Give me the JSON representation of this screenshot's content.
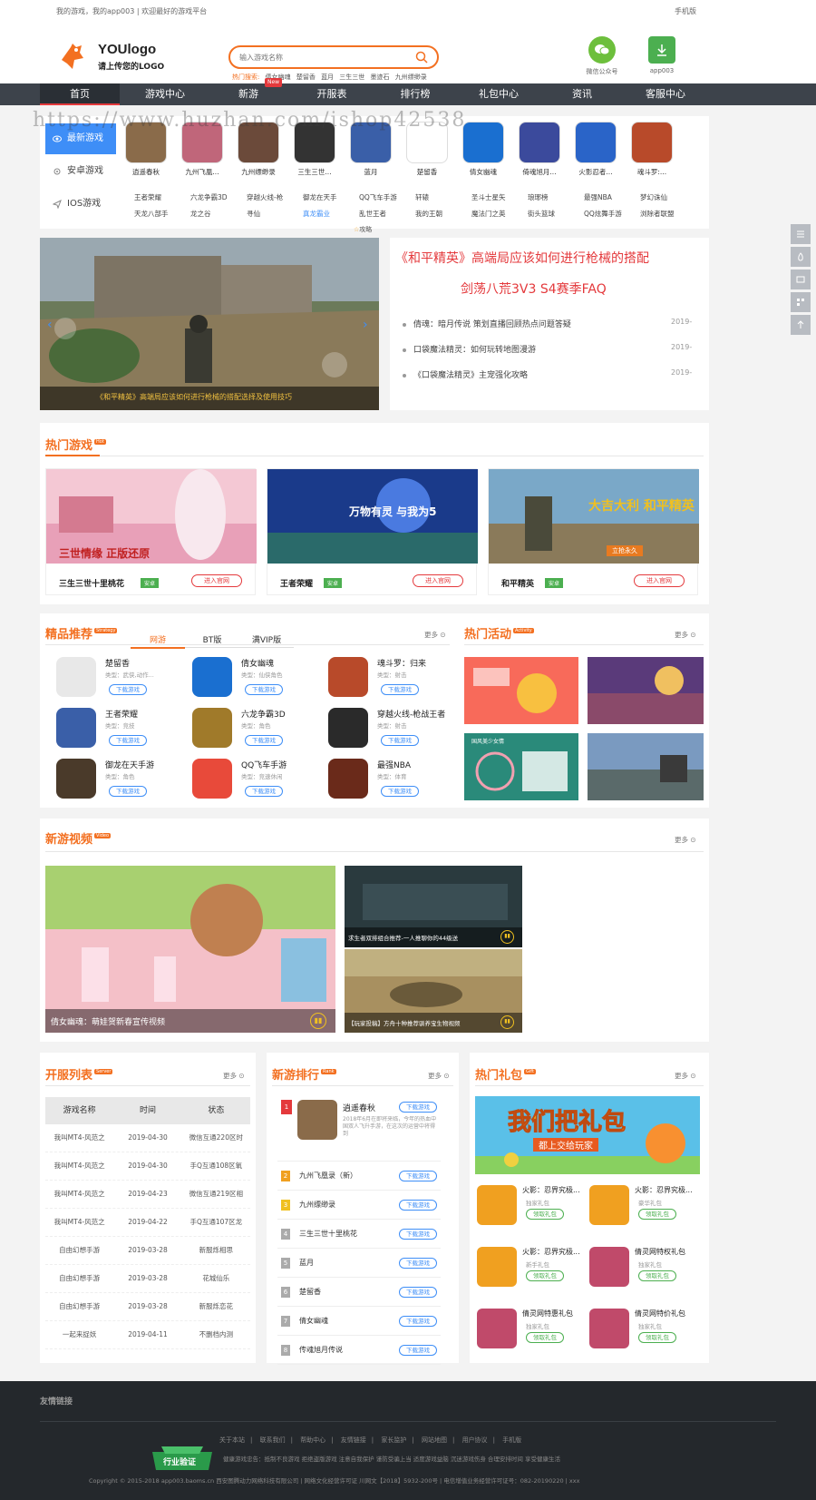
{
  "topbar": {
    "left": "我的游戏，我的app003 | 欢迎最好的游戏平台",
    "right": "手机版"
  },
  "logo": {
    "title": "YOUlogo",
    "subtitle": "请上传您的LOGO"
  },
  "search": {
    "placeholder": "输入游戏名称",
    "hot_label": "热门搜索:",
    "hot": [
      "倩女幽魂",
      "楚留香",
      "蓝月",
      "三生三世",
      "墨迹石",
      "九州缥缈录"
    ]
  },
  "header_btns": [
    {
      "label": "微信公众号",
      "icon": "wechat-icon"
    },
    {
      "label": "app003",
      "icon": "download-icon"
    }
  ],
  "nav": {
    "items": [
      "首页",
      "游戏中心",
      "新游",
      "开服表",
      "排行榜",
      "礼包中心",
      "资讯",
      "客服中心"
    ],
    "new_badge": "New"
  },
  "watermark": "https://www.huzhan.com/ishop42538",
  "platform_tabs": [
    "最新游戏",
    "安卓游戏",
    "IOS游戏"
  ],
  "latest_games": [
    {
      "name": "逍遥春秋",
      "color": "#8a6b4a"
    },
    {
      "name": "九州飞凰...",
      "color": "#c0667a"
    },
    {
      "name": "九州缥缈录",
      "color": "#6b4a3a"
    },
    {
      "name": "三生三世...",
      "color": "#333333"
    },
    {
      "name": "蓝月",
      "color": "#3a5fa8"
    },
    {
      "name": "楚留香",
      "color": "#ffffff"
    },
    {
      "name": "倩女幽魂",
      "color": "#1a6fd0"
    },
    {
      "name": "倚魂旭月...",
      "color": "#3b4a9c"
    },
    {
      "name": "火影忍者...",
      "color": "#2a64c8"
    },
    {
      "name": "魂斗罗:...",
      "color": "#b84a2a"
    }
  ],
  "name_rows": [
    [
      "王者荣耀",
      "六龙争霸3D",
      "穿越火线-枪",
      "御龙在天手",
      "QQ飞车手游",
      "轩辕",
      "圣斗士星矢",
      "琅琊榜",
      "最强NBA",
      "梦幻诛仙"
    ],
    [
      "天龙八部手",
      "龙之谷",
      "寻仙",
      "真龙霸业",
      "乱世王者",
      "我的王朝",
      "魔法门之英",
      "街头篮球",
      "QQ炫舞手游",
      "浏除者联盟"
    ]
  ],
  "strategy_label": "攻略",
  "banner": {
    "caption": "《和平精英》高端局应该如何进行枪械的搭配选择及使用技巧"
  },
  "headline": {
    "line1": "《和平精英》高端局应该如何进行枪械的搭配",
    "line2": "剑荡八荒3V3 S4赛季FAQ"
  },
  "news": [
    {
      "title": "倩魂：暗月传说 策划直播回顾热点问题答疑",
      "date": "2019-"
    },
    {
      "title": "口袋魔法精灵：如何玩转地图漫游",
      "date": "2019-"
    },
    {
      "title": "《口袋魔法精灵》主宠强化攻略",
      "date": "2019-"
    }
  ],
  "hot_games": {
    "title": "热门游戏",
    "tag": "Hot",
    "items": [
      {
        "name": "三生三世十里桃花",
        "platform": "安卓",
        "btn": "进入官网",
        "banner": "三世情缘 正版还原"
      },
      {
        "name": "王者荣耀",
        "platform": "安卓",
        "btn": "进入官网",
        "banner": "万物有灵 与我为5"
      },
      {
        "name": "和平精英",
        "platform": "安卓",
        "btn": "进入官网",
        "banner": "大吉大利 和平精英",
        "sub": "立抢永久"
      }
    ]
  },
  "recommend": {
    "title": "精品推荐",
    "tag": "Strategy",
    "tabs": [
      "网游",
      "BT版",
      "满VIP版"
    ],
    "more": "更多",
    "items": [
      {
        "name": "楚留香",
        "type": "类型：武侠,动作...",
        "btn": "下载游戏",
        "color": "#e8e8e8"
      },
      {
        "name": "倩女幽魂",
        "type": "类型：仙侠角色",
        "btn": "下载游戏",
        "color": "#1a6fd0"
      },
      {
        "name": "魂斗罗：归来",
        "type": "类型：射击",
        "btn": "下载游戏",
        "color": "#b84a2a"
      },
      {
        "name": "王者荣耀",
        "type": "类型：竞技",
        "btn": "下载游戏",
        "color": "#3a5fa8"
      },
      {
        "name": "六龙争霸3D",
        "type": "类型：角色",
        "btn": "下载游戏",
        "color": "#a07a2a"
      },
      {
        "name": "穿越火线-枪战王者",
        "type": "类型：射击",
        "btn": "下载游戏",
        "color": "#2a2a2a"
      },
      {
        "name": "御龙在天手游",
        "type": "类型：角色",
        "btn": "下载游戏",
        "color": "#4a3a2a"
      },
      {
        "name": "QQ飞车手游",
        "type": "类型：竞速休闲",
        "btn": "下载游戏",
        "color": "#e84a3a"
      },
      {
        "name": "最强NBA",
        "type": "类型：体育",
        "btn": "下载游戏",
        "color": "#6a2a1a"
      }
    ]
  },
  "activity": {
    "title": "热门活动",
    "tag": "Activity",
    "more": "更多",
    "overlay_label": "国风美少女情"
  },
  "videos": {
    "title": "新游视频",
    "tag": "Video",
    "more": "更多",
    "items": [
      {
        "caption": "倩女幽魂：萌娃贺新春宣传视频"
      },
      {
        "caption": "求生者双排组合推荐-一人推聊你的44级送"
      },
      {
        "caption": "【玩家投稿】方舟十种推荐驯养宝生物视频"
      }
    ]
  },
  "server_list": {
    "title": "开服列表",
    "tag": "Server",
    "more": "更多",
    "headers": [
      "游戏名称",
      "时间",
      "状态"
    ],
    "rows": [
      [
        "我叫MT4-风范之",
        "2019-04-30",
        "微信互通220区时"
      ],
      [
        "我叫MT4-风范之",
        "2019-04-30",
        "手Q互通108区氧"
      ],
      [
        "我叫MT4-风范之",
        "2019-04-23",
        "微信互通219区相"
      ],
      [
        "我叫MT4-风范之",
        "2019-04-22",
        "手Q互通107区龙"
      ],
      [
        "自由幻想手游",
        "2019-03-28",
        "新服烁相思"
      ],
      [
        "自由幻想手游",
        "2019-03-28",
        "花城仙乐"
      ],
      [
        "自由幻想手游",
        "2019-03-28",
        "新服烁恋花"
      ],
      [
        "一起来捉妖",
        "2019-04-11",
        "不删档内测"
      ]
    ]
  },
  "new_rank": {
    "title": "新游排行",
    "tag": "Rank",
    "more": "更多",
    "top": {
      "name": "逍遥春秋",
      "desc": "2018年6月在即将来临，今年的热血中国双人飞升手游，在这次的运营中将得到",
      "btn": "下载游戏"
    },
    "items": [
      {
        "num": "2",
        "name": "九州飞凰录（新）",
        "btn": "下载游戏"
      },
      {
        "num": "3",
        "name": "九州缥缈录",
        "btn": "下载游戏"
      },
      {
        "num": "4",
        "name": "三生三世十里桃花",
        "btn": "下载游戏"
      },
      {
        "num": "5",
        "name": "蓝月",
        "btn": "下载游戏"
      },
      {
        "num": "6",
        "name": "楚留香",
        "btn": "下载游戏"
      },
      {
        "num": "7",
        "name": "倩女幽魂",
        "btn": "下载游戏"
      },
      {
        "num": "8",
        "name": "传魂旭月传说",
        "btn": "下载游戏"
      }
    ]
  },
  "gifts": {
    "title": "热门礼包",
    "tag": "Gift",
    "more": "更多",
    "banner_line1": "我们把礼包",
    "banner_line2": "都上交给玩家",
    "items": [
      {
        "name": "火影：忍界究极...",
        "type": "独家礼包",
        "btn": "领取礼包",
        "color": "#f0a020"
      },
      {
        "name": "火影：忍界究极...",
        "type": "豪华礼包",
        "btn": "领取礼包",
        "color": "#f0a020"
      },
      {
        "name": "火影：忍界究极...",
        "type": "新手礼包",
        "btn": "领取礼包",
        "color": "#f0a020"
      },
      {
        "name": "倩灵网特权礼包",
        "type": "独家礼包",
        "btn": "领取礼包",
        "color": "#c04a6a"
      },
      {
        "name": "倩灵网特惠礼包",
        "type": "独家礼包",
        "btn": "领取礼包",
        "color": "#c04a6a"
      },
      {
        "name": "倩灵网特价礼包",
        "type": "独家礼包",
        "btn": "领取礼包",
        "color": "#c04a6a"
      }
    ]
  },
  "footer": {
    "friend_links": "友情链接",
    "links": [
      "关于本站",
      "联系我们",
      "帮助中心",
      "友情链接",
      "家长监护",
      "网站地图",
      "用户协议",
      "手机版"
    ],
    "notice": "健康游戏忠告：抵制不良游戏 拒绝盗版游戏 注意自我保护 谨防受骗上当 适度游戏益脑 沉迷游戏伤身 合理安排时间 享受健康生活",
    "copy": "Copyright © 2015-2018  app003.baoms.cn  西安图腾动力网络科技有限公司 | 网络文化经营许可证 川网文【2018】5932-200号 | 电信增值业务经营许可证号：082-20190220 | xxx",
    "badge": "行业验证"
  }
}
